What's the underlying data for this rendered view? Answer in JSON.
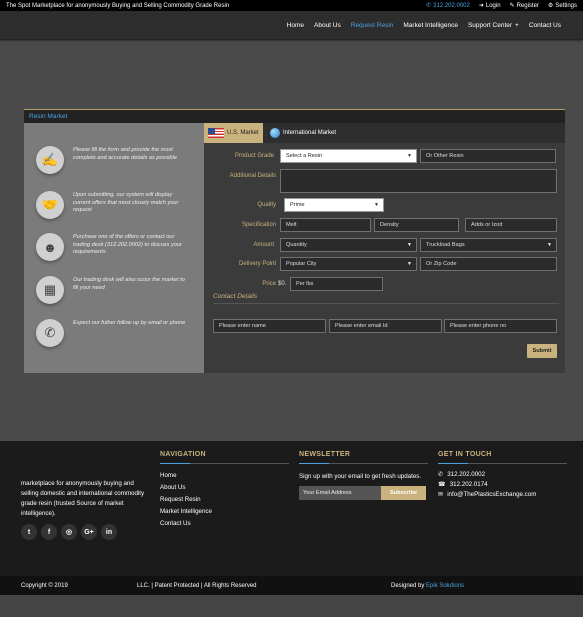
{
  "topbar": {
    "message": "The Spot Marketplace for anonymously Buying and Selling Commodity Grade Resin",
    "phone": "312.202.0002",
    "login": "Login",
    "register": "Register",
    "settings": "Settings"
  },
  "nav": {
    "items": [
      "Home",
      "About Us",
      "Request Resin",
      "Market Intelligence",
      "Support Center",
      "Contact Us"
    ],
    "active": "Request Resin",
    "support_plus": "+"
  },
  "panel": {
    "title": "Resin Market"
  },
  "steps": [
    {
      "icon": "form-icon",
      "text": "Please fill the form and provide the most complete and accurate details as possible"
    },
    {
      "icon": "handshake-icon",
      "text": "Upon submitting, our system will display current offers that most closely match your request"
    },
    {
      "icon": "support-agent-icon",
      "text": "Purchase one of the offers or contact our trading desk (312.202.0002) to discuss your requirements"
    },
    {
      "icon": "presentation-icon",
      "text": "Our trading desk will also scour the market to fill your need"
    },
    {
      "icon": "phone-icon",
      "text": "Expect our futher follow up by email or phone"
    }
  ],
  "tabs": {
    "us": "U.S. Market",
    "intl": "International Market"
  },
  "form": {
    "product_grade": {
      "label": "Product Grade",
      "select": "Select a Resin",
      "other": "Or Other Resin"
    },
    "additional_details": {
      "label": "Additional Details",
      "value": ""
    },
    "quality": {
      "label": "Quality",
      "value": "Prime"
    },
    "specification": {
      "label": "Specification",
      "melt": "Melt",
      "density": "Density",
      "adds": "Adds or Izod"
    },
    "amount": {
      "label": "Amount",
      "quantity": "Quantity",
      "packaging": "Truckload Bags"
    },
    "delivery": {
      "label": "Delivery Point",
      "city": "Popular City",
      "zip": "Or Zip Code"
    },
    "price": {
      "label": "Price",
      "currency": "$0.",
      "unit": "Per lbs"
    },
    "contact": {
      "heading": "Contact Details",
      "name": "Please enter  name",
      "email": "Please enter email Id",
      "phone": "Please enter  phone no"
    },
    "submit": "Submit"
  },
  "footer": {
    "about": "marketplace for anonymously buying and selling domestic and international commodity grade resin (trusted Source of market intelligence).",
    "socials": [
      "twitter-icon",
      "facebook-icon",
      "instagram-icon",
      "google-plus-icon",
      "linkedin-icon"
    ],
    "social_glyphs": [
      "t",
      "f",
      "◎",
      "G+",
      "in"
    ],
    "navigation": {
      "heading": "NAVIGATION",
      "items": [
        "Home",
        "About Us",
        "Request Resin",
        "Market Intelligence",
        "Contact Us"
      ]
    },
    "newsletter": {
      "heading": "NEWSLETTER",
      "text": "Sign up with your email to get fresh updates.",
      "placeholder": "Your Email Address",
      "button": "Subscribe"
    },
    "contact": {
      "heading": "GET IN TOUCH",
      "phone1": "312.202.0002",
      "phone2": "312.202.0174",
      "email": "info@ThePlasticsExchange.com"
    }
  },
  "bottom": {
    "copyright": "Copyright © 2019",
    "middle": "LLC. | Patent Protected | All Rights Reserved",
    "designed_by": "Designed by ",
    "designer": "Epik Solutions"
  },
  "colors": {
    "accent": "#c9b27d",
    "link": "#4aa3e0"
  }
}
